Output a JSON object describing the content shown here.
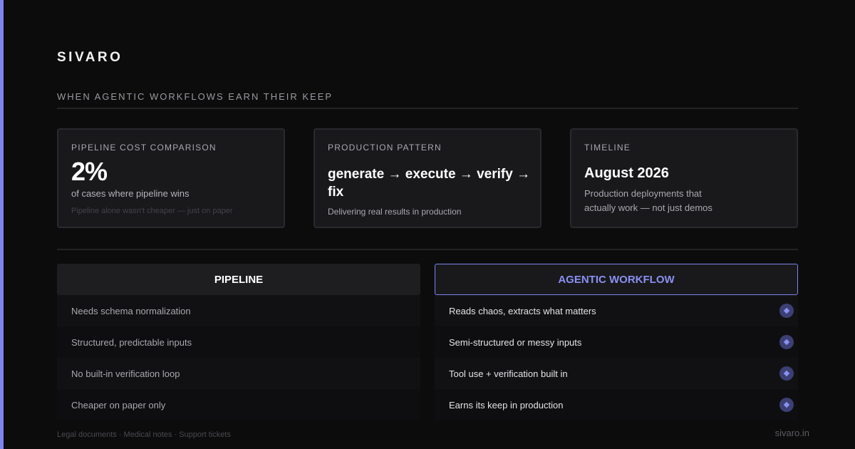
{
  "brand": "SIVARO",
  "kicker": "WHEN AGENTIC WORKFLOWS EARN THEIR KEEP",
  "colors": {
    "accent": "#7c84ee",
    "background": "#0c0c0d",
    "card": "#19191c"
  },
  "cards": [
    {
      "label": "PIPELINE COST COMPARISON",
      "stat": "2%",
      "caption": "of cases where pipeline wins",
      "note": "Pipeline alone wasn't cheaper — just on paper"
    },
    {
      "label": "PRODUCTION PATTERN",
      "headline": "generate → execute → verify → fix",
      "caption": "Delivering real results in production"
    },
    {
      "label": "TIMELINE",
      "headline": "August 2026",
      "caption": "Production deployments that actually work — not just demos"
    }
  ],
  "comparison": {
    "pipeline": {
      "title": "PIPELINE",
      "rows": [
        "Needs schema normalization",
        "Structured, predictable inputs",
        "No built-in verification loop",
        "Cheaper on paper only"
      ]
    },
    "agentic": {
      "title": "AGENTIC WORKFLOW",
      "marker_icon": "diamond-icon",
      "rows": [
        "Reads chaos, extracts what matters",
        "Semi-structured or messy inputs",
        "Tool use + verification built in",
        "Earns its keep in production"
      ]
    }
  },
  "footer": {
    "tags": "Legal documents · Medical notes · Support tickets",
    "site": "sivaro.in"
  }
}
